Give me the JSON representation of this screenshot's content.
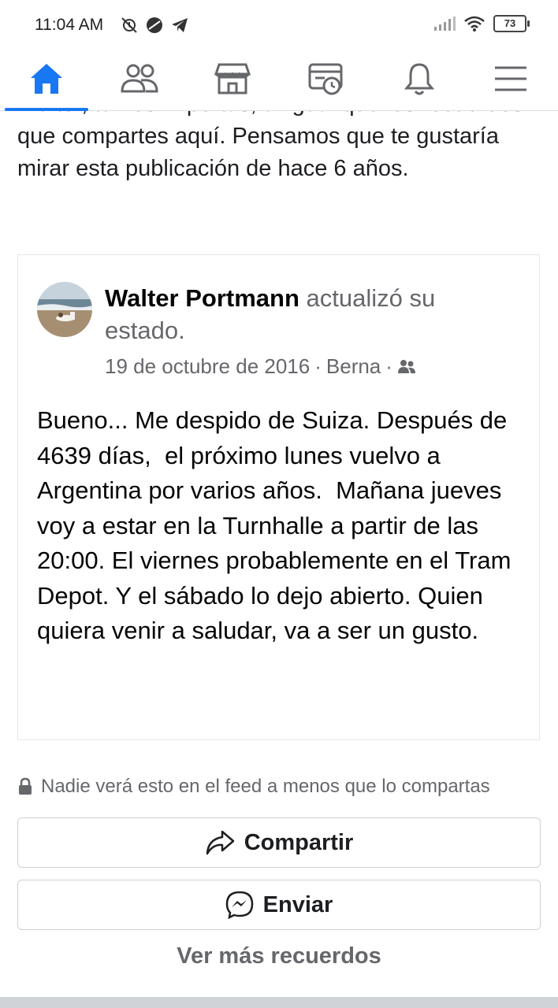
{
  "status_bar": {
    "time": "11:04 AM",
    "battery": "73",
    "icons_left": [
      "alarm-off-icon",
      "app-circle-icon",
      "telegram-icon"
    ],
    "icons_right": [
      "signal-icon",
      "wifi-icon",
      "battery-icon"
    ]
  },
  "nav": {
    "items": [
      {
        "name": "home",
        "icon": "home-icon",
        "active": true
      },
      {
        "name": "friends",
        "icon": "friends-icon",
        "active": false
      },
      {
        "name": "marketplace",
        "icon": "marketplace-icon",
        "active": false
      },
      {
        "name": "memories",
        "icon": "memories-icon",
        "active": false
      },
      {
        "name": "notifications",
        "icon": "bell-icon",
        "active": false
      },
      {
        "name": "menu",
        "icon": "menu-icon",
        "active": false
      }
    ],
    "accent": "#1877f2"
  },
  "intro": {
    "text": "Walter, tu nos importas, al igual que los recuerdos que compartes aquí. Pensamos que te gustaría mirar esta publicación de hace 6 años."
  },
  "post": {
    "author": "Walter Portmann",
    "action": " actualizó su estado.",
    "date": "19 de octubre de 2016",
    "separator": " · ",
    "location": "Berna",
    "audience_icon": "friends-audience-icon",
    "body": "Bueno... Me despido de Suiza. Después de 4639 días,  el próximo lunes vuelvo a Argentina por varios años.  Mañana jueves voy a estar en la Turnhalle a partir de las 20:00. El viernes probablemente en el Tram Depot. Y el sábado lo dejo abierto. Quien quiera venir a saludar, va a ser un gusto."
  },
  "privacy_note": "Nadie verá esto en el feed a menos que lo compartas",
  "buttons": {
    "share": "Compartir",
    "send": "Enviar"
  },
  "more_memories": "Ver más recuerdos"
}
